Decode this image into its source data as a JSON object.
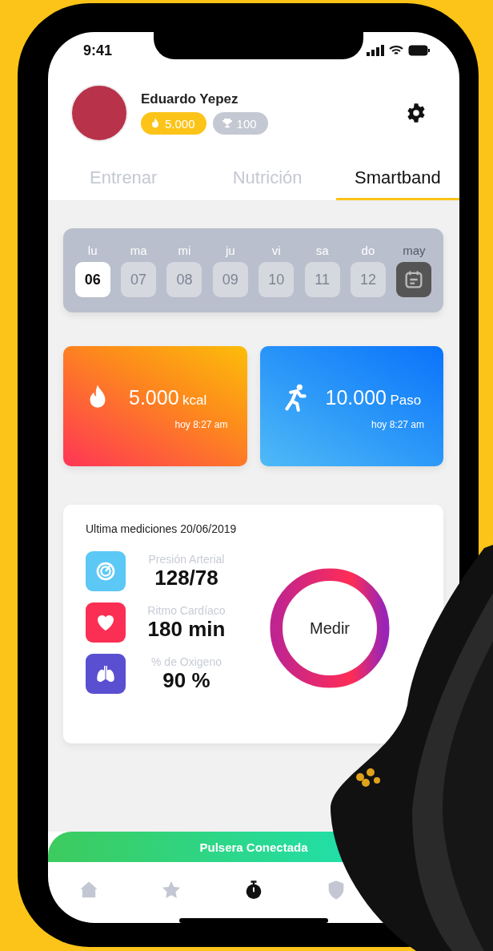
{
  "status_bar": {
    "time": "9:41"
  },
  "profile": {
    "name": "Eduardo Yepez",
    "points": "5.000",
    "trophies": "100"
  },
  "tabs": [
    {
      "label": "Entrenar",
      "selected": false
    },
    {
      "label": "Nutrición",
      "selected": false
    },
    {
      "label": "Smartband",
      "selected": true
    }
  ],
  "week": {
    "month": "may",
    "days": [
      {
        "weekday": "lu",
        "date": "06",
        "selected": true
      },
      {
        "weekday": "ma",
        "date": "07",
        "selected": false
      },
      {
        "weekday": "mi",
        "date": "08",
        "selected": false
      },
      {
        "weekday": "ju",
        "date": "09",
        "selected": false
      },
      {
        "weekday": "vi",
        "date": "10",
        "selected": false
      },
      {
        "weekday": "sa",
        "date": "11",
        "selected": false
      },
      {
        "weekday": "do",
        "date": "12",
        "selected": false
      }
    ]
  },
  "stats": [
    {
      "kind": "calories",
      "value": "5.000",
      "unit": "kcal",
      "time": "hoy 8:27 am"
    },
    {
      "kind": "steps",
      "value": "10.000",
      "unit": "Paso",
      "time": "hoy 8:27 am"
    }
  ],
  "measurements": {
    "title": "Ultima mediciones 20/06/2019",
    "button": "Medir",
    "items": [
      {
        "kind": "pressure",
        "label": "Presión Arterial",
        "value": "128/78"
      },
      {
        "kind": "heart",
        "label": "Ritmo Cardíaco",
        "value": "180 min"
      },
      {
        "kind": "oxygen",
        "label": "% de Oxigeno",
        "value": "90 %"
      }
    ]
  },
  "connection_banner": "Pulsera Conectada",
  "bottom_nav": [
    {
      "kind": "home",
      "selected": false
    },
    {
      "kind": "star",
      "selected": false
    },
    {
      "kind": "timer",
      "selected": true
    },
    {
      "kind": "shield",
      "selected": false
    }
  ]
}
